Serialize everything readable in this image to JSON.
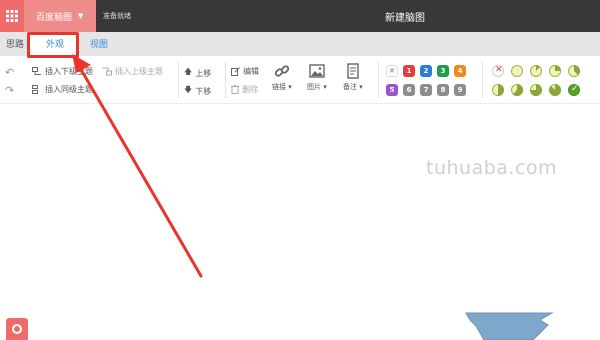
{
  "header": {
    "app_button_label": "百度脑图",
    "status_text": "准备就绪",
    "document_title": "新建脑图"
  },
  "tabs": [
    {
      "label": "思路"
    },
    {
      "label": "外观"
    },
    {
      "label": "视图"
    }
  ],
  "toolbar": {
    "insert_child": "插入下级主题",
    "insert_parent": "插入上级主题",
    "insert_sibling": "插入同级主题",
    "move_up": "上移",
    "move_down": "下移",
    "edit": "编辑",
    "delete": "删除",
    "link": "链接",
    "image": "图片",
    "note": "备注",
    "priority": [
      "1",
      "2",
      "3",
      "4",
      "5",
      "6",
      "7",
      "8",
      "9"
    ],
    "priority_colors": [
      "#e33d3d",
      "#2f7bd8",
      "#1e9e4a",
      "#f08a1c",
      "#9b55c9",
      "#8d8d8d",
      "#8d8d8d",
      "#8d8d8d",
      "#8d8d8d"
    ],
    "progress_levels": [
      "0",
      "1/8",
      "2/8",
      "3/8",
      "4/8",
      "5/8",
      "6/8",
      "7/8",
      "done"
    ]
  },
  "watermark": "tuhuaba.com",
  "annotation_color": "#e8342b"
}
